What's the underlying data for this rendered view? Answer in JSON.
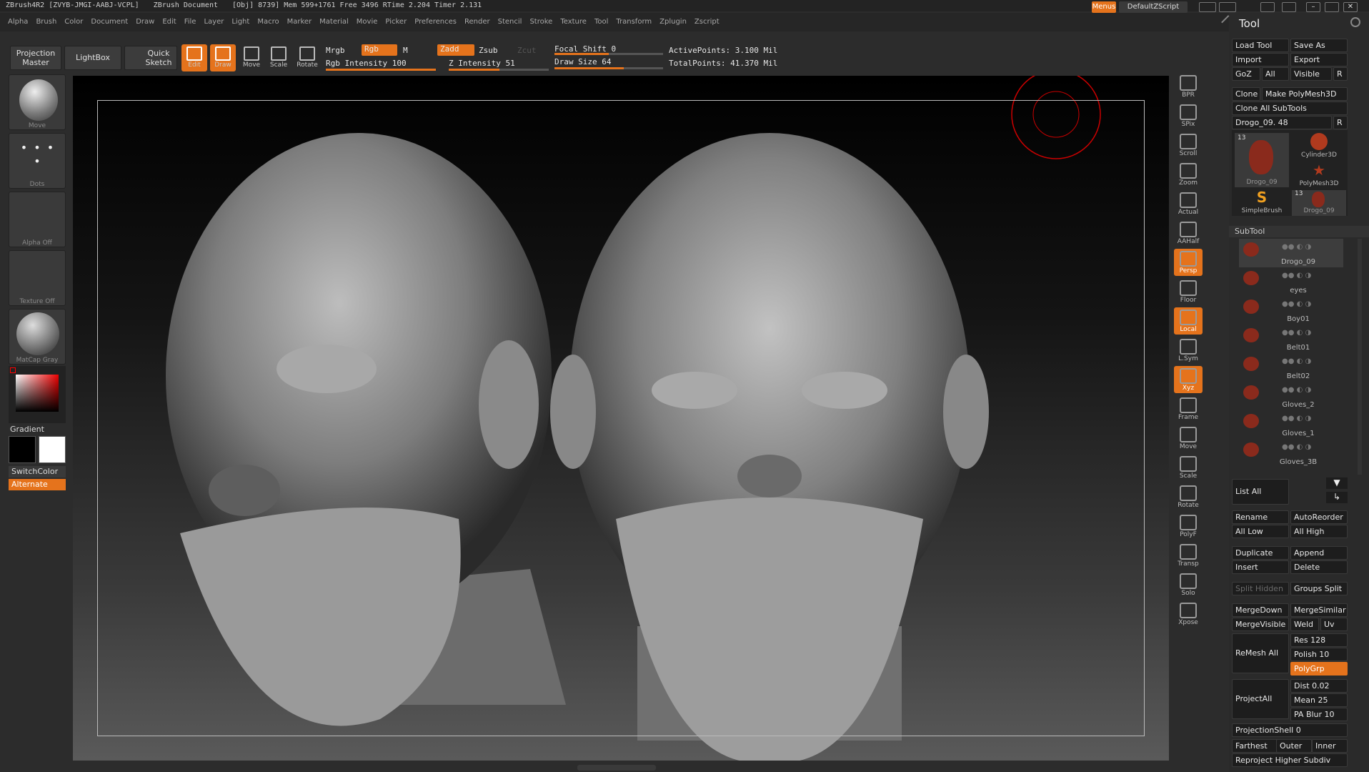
{
  "titlebar": {
    "text": "ZBrush4R2 [ZVYB-JMGI-AABJ-VCPL]",
    "doc": "ZBrush Document",
    "stats": "[Obj] 8739] Mem 599+1761 Free 3496 RTime 2.204 Timer 2.131"
  },
  "menus": [
    "Alpha",
    "Brush",
    "Color",
    "Document",
    "Draw",
    "Edit",
    "File",
    "Layer",
    "Light",
    "Macro",
    "Marker",
    "Material",
    "Movie",
    "Picker",
    "Preferences",
    "Render",
    "Stencil",
    "Stroke",
    "Texture",
    "Tool",
    "Transform",
    "Zplugin",
    "Zscript"
  ],
  "topright": {
    "menus_label": "Menus",
    "script_label": "DefaultZScript"
  },
  "toolbar": {
    "projection_master": "Projection Master",
    "lightbox": "LightBox",
    "quick_sketch": "Quick Sketch",
    "edit": "Edit",
    "draw": "Draw",
    "move": "Move",
    "scale": "Scale",
    "rotate": "Rotate",
    "mrgb": "Mrgb",
    "rgb": "Rgb",
    "m": "M",
    "zadd": "Zadd",
    "zsub": "Zsub",
    "zcut": "Zcut",
    "rgb_intensity": "Rgb Intensity 100",
    "z_intensity": "Z Intensity 51",
    "focal_shift": "Focal Shift 0",
    "draw_size": "Draw Size 64",
    "active_points": "ActivePoints: 3.100 Mil",
    "total_points": "TotalPoints: 41.370 Mil",
    "rgb_intensity_value": 1.0,
    "z_intensity_value": 0.51,
    "focal_shift_value": 0.5,
    "draw_size_value": 0.64
  },
  "leftpanel": {
    "move": "Move",
    "dots": "Dots",
    "alpha": "Alpha Off",
    "texture": "Texture Off",
    "matcap": "MatCap Gray",
    "gradient": "Gradient",
    "switchcolor": "SwitchColor",
    "alternate": "Alternate"
  },
  "rightstrip": [
    "BPR",
    "SPix",
    "Scroll",
    "Zoom",
    "Actual",
    "AAHalf",
    "Persp",
    "Floor",
    "Local",
    "L.Sym",
    "Xyz",
    "Frame",
    "Move",
    "Scale",
    "Rotate",
    "PolyF",
    "Transp",
    "Solo",
    "Xpose"
  ],
  "tool": {
    "title": "Tool",
    "load_tool": "Load Tool",
    "save_as": "Save As",
    "import": "Import",
    "export": "Export",
    "goz": "GoZ",
    "all": "All",
    "visible": "Visible",
    "r": "R",
    "clone": "Clone",
    "make_polymesh": "Make PolyMesh3D",
    "clone_all": "Clone All SubTools",
    "current": "Drogo_09. 48",
    "thumbs": [
      "Drogo_09",
      "Cylinder3D",
      "PolyMesh3D",
      "SimpleBrush",
      "Drogo_09"
    ],
    "thumb_count": "13",
    "subtool_header": "SubTool",
    "subtools": [
      "Drogo_09",
      "eyes",
      "Boy01",
      "Belt01",
      "Belt02",
      "Gloves_2",
      "Gloves_1",
      "Gloves_3B"
    ],
    "list_all": "List All",
    "rename": "Rename",
    "autoreorder": "AutoReorder",
    "all_low": "All Low",
    "all_high": "All High",
    "duplicate": "Duplicate",
    "append": "Append",
    "insert": "Insert",
    "delete": "Delete",
    "split_hidden": "Split Hidden",
    "groups_split": "Groups Split",
    "mergedown": "MergeDown",
    "mergesimilar": "MergeSimilar",
    "mergevisible": "MergeVisible",
    "weld": "Weld",
    "uv": "Uv",
    "remesh_all": "ReMesh All",
    "res": "Res 128",
    "polish": "Polish 10",
    "polygrp": "PolyGrp",
    "project_all": "ProjectAll",
    "dist": "Dist 0.02",
    "mean": "Mean 25",
    "pa_blur": "PA Blur 10",
    "projection_shell": "ProjectionShell 0",
    "farthest": "Farthest",
    "outer": "Outer",
    "inner": "Inner",
    "reproject": "Reproject Higher Subdiv"
  }
}
